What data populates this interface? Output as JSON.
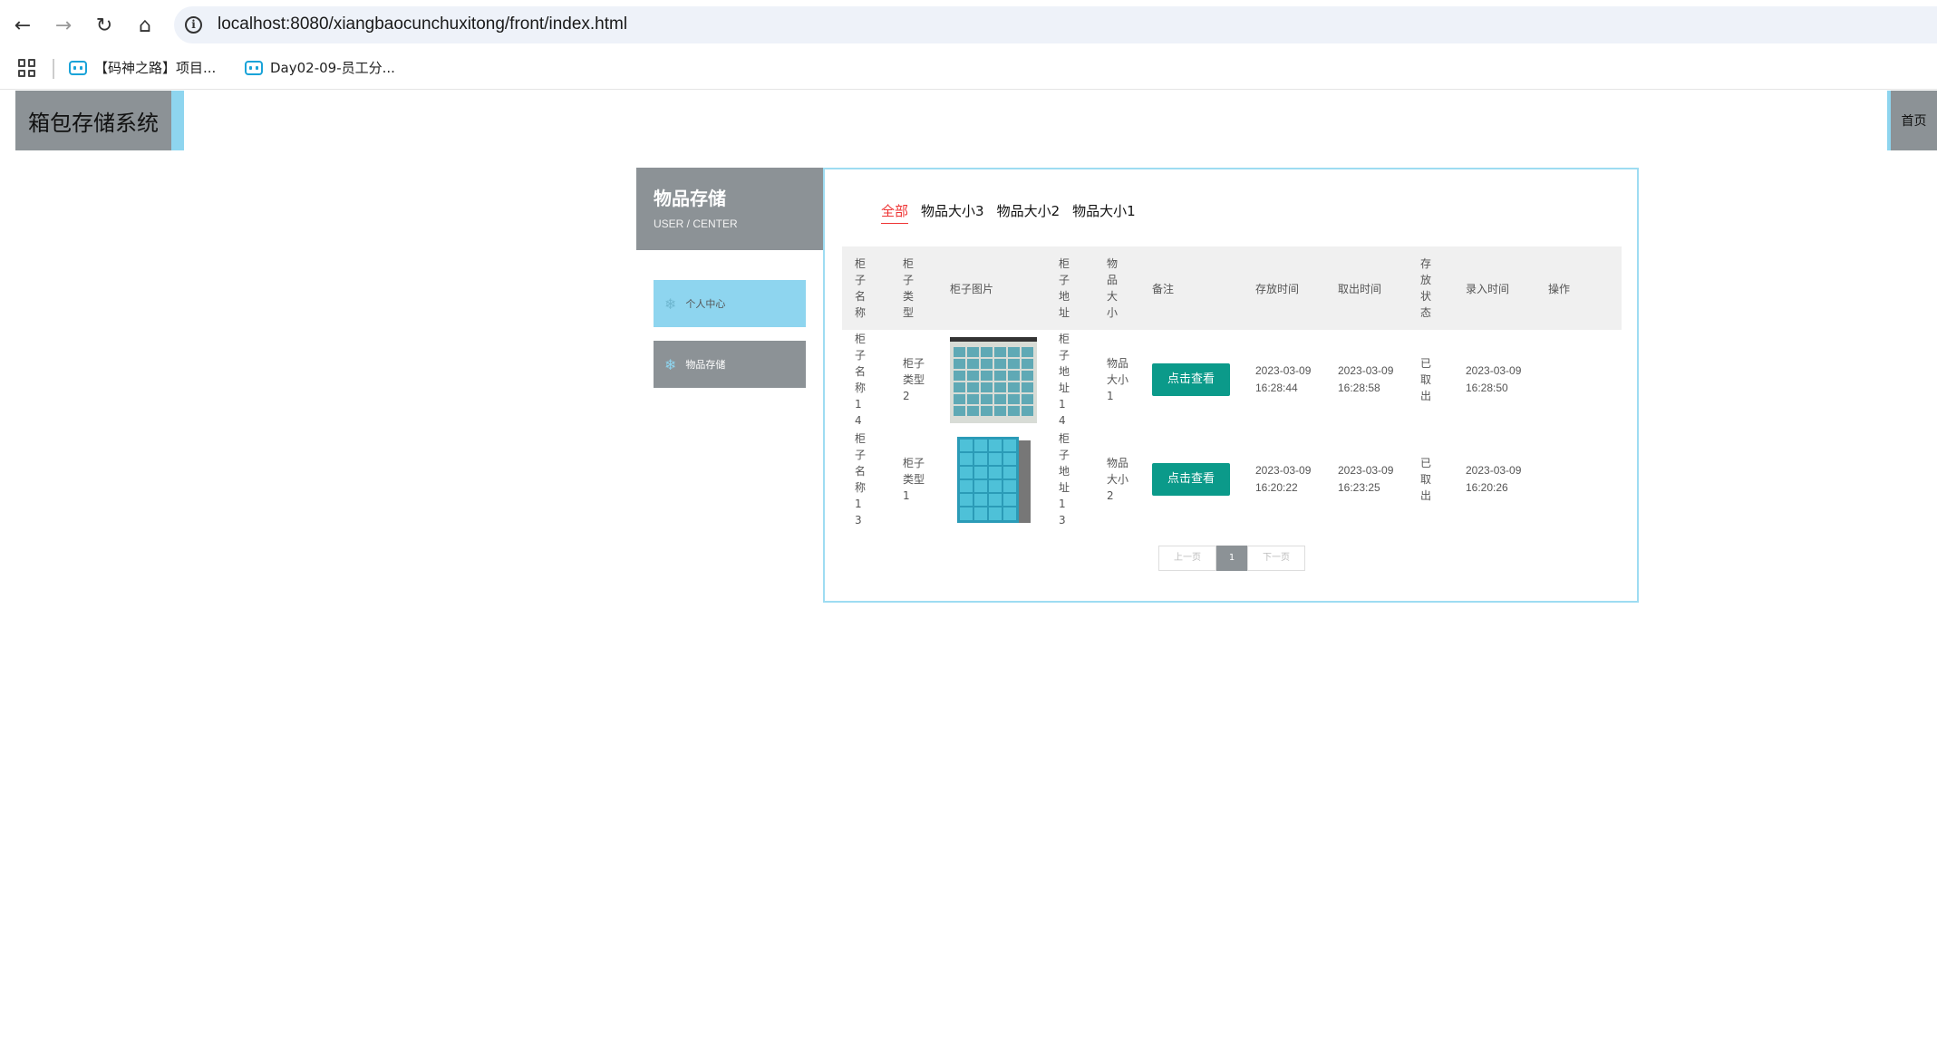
{
  "browser": {
    "url": "localhost:8080/xiangbaocunchuxitong/front/index.html",
    "bookmarks": [
      "【码神之路】项目...",
      "Day02-09-员工分..."
    ]
  },
  "header": {
    "site_title": "箱包存储系统",
    "home_label": "首页"
  },
  "sidebar": {
    "title": "物品存储",
    "subtitle": "USER / CENTER",
    "items": [
      {
        "label": "个人中心"
      },
      {
        "label": "物品存储"
      }
    ]
  },
  "filters": [
    "全部",
    "物品大小3",
    "物品大小2",
    "物品大小1"
  ],
  "table": {
    "columns": [
      "柜子名称",
      "柜子类型",
      "柜子图片",
      "柜子地址",
      "物品大小",
      "备注",
      "存放时间",
      "取出时间",
      "存放状态",
      "录入时间",
      "操作"
    ],
    "rows": [
      {
        "name": "柜子名称14",
        "type": "柜子类型2",
        "address": "柜子地址14",
        "size": "物品大小1",
        "remark_button": "点击查看",
        "store_time": "2023-03-09 16:28:44",
        "take_time": "2023-03-09 16:28:58",
        "status": "已取出",
        "entry_time": "2023-03-09 16:28:50"
      },
      {
        "name": "柜子名称13",
        "type": "柜子类型1",
        "address": "柜子地址13",
        "size": "物品大小2",
        "remark_button": "点击查看",
        "store_time": "2023-03-09 16:20:22",
        "take_time": "2023-03-09 16:23:25",
        "status": "已取出",
        "entry_time": "2023-03-09 16:20:26"
      }
    ]
  },
  "pager": {
    "prev": "上一页",
    "current": "1",
    "next": "下一页"
  }
}
